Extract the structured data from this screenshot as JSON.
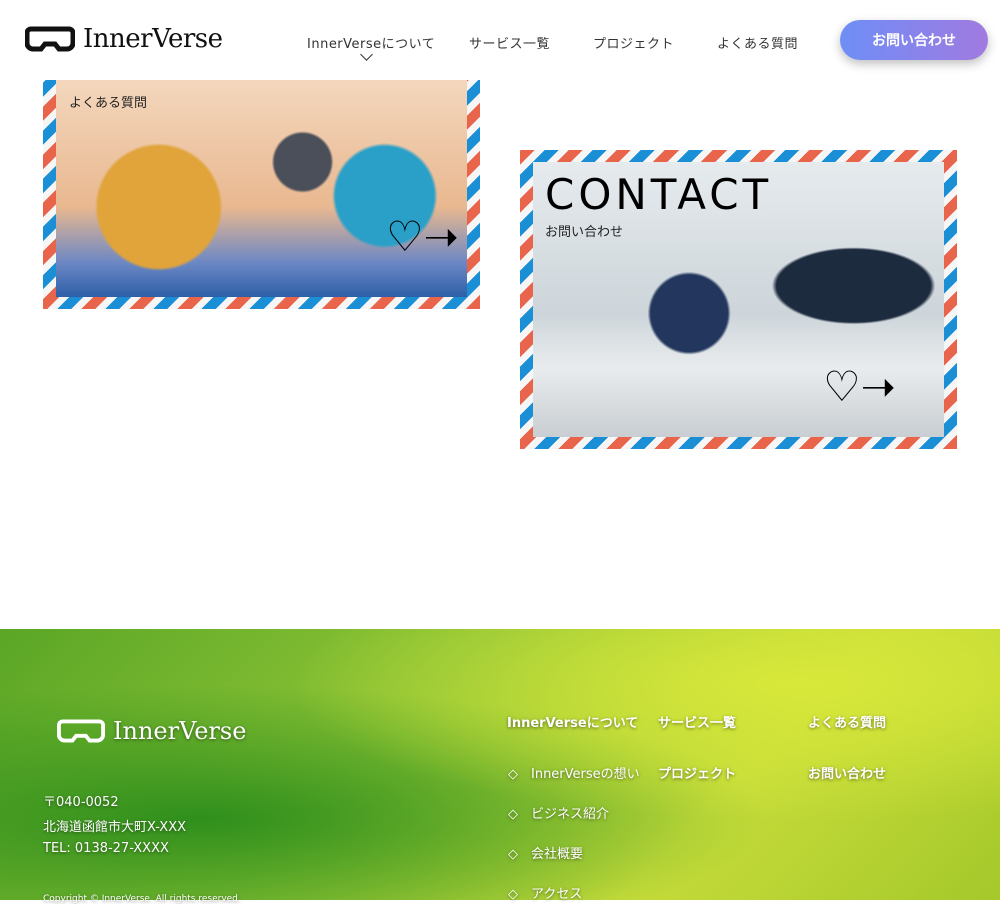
{
  "header": {
    "logo": "InnerVerse",
    "nav": [
      "InnerVerseについて",
      "サービス一覧",
      "プロジェクト",
      "よくある質問"
    ],
    "cta": "お問い合わせ"
  },
  "cards": [
    {
      "label": "よくある質問"
    },
    {
      "title": "CONTACT",
      "label": "お問い合わせ"
    }
  ],
  "colors": {
    "stripe_red": "#e8644a",
    "stripe_blue": "#1a8fd6",
    "cta_start": "#6e8ef7",
    "cta_end": "#a07ae0"
  },
  "footer": {
    "logo": "InnerVerse",
    "postal": "〒040-0052",
    "address": "北海道函館市大町X-XXX",
    "tel": "TEL: 0138-27-XXXX",
    "copyright": "Copyright © InnerVerse. All rights reserved.",
    "nav": {
      "about": "InnerVerseについて",
      "about_sub": [
        "◇　InnerVerseの想い",
        "◇　ビジネス紹介",
        "◇　会社概要",
        "◇　アクセス"
      ],
      "services": "サービス一覧",
      "projects": "プロジェクト",
      "faq": "よくある質問",
      "contact": "お問い合わせ"
    }
  }
}
